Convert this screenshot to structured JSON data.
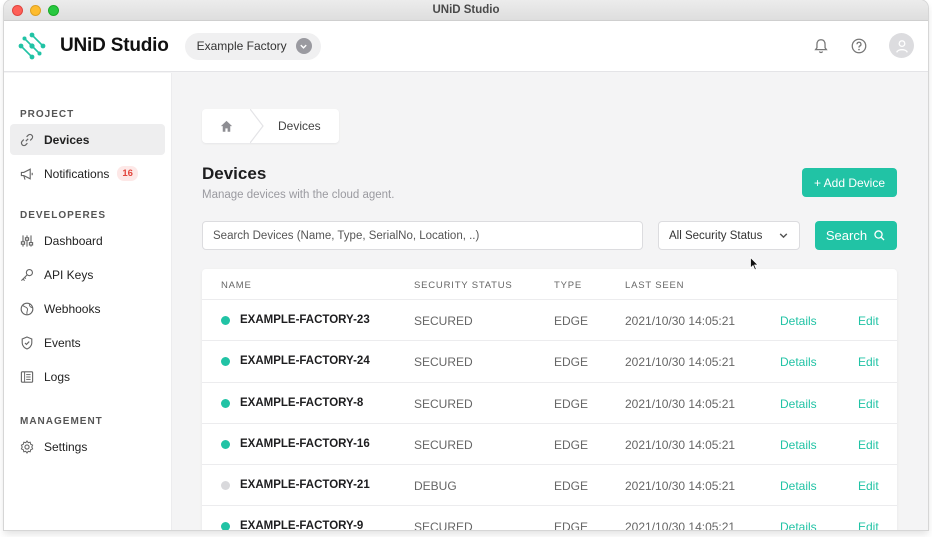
{
  "window": {
    "title": "UNiD Studio"
  },
  "brand": {
    "name": "UNiD Studio",
    "logo": "unid-logo-icon",
    "accent": "#21c3a5"
  },
  "project_selector": {
    "value": "Example Factory"
  },
  "sidebar": {
    "sections": [
      {
        "title": "PROJECT",
        "items": [
          {
            "label": "Devices",
            "icon": "link-icon",
            "active": true
          },
          {
            "label": "Notifications",
            "icon": "megaphone-icon",
            "badge": "16"
          }
        ]
      },
      {
        "title": "DEVELOPERES",
        "items": [
          {
            "label": "Dashboard",
            "icon": "sliders-icon"
          },
          {
            "label": "API Keys",
            "icon": "key-icon"
          },
          {
            "label": "Webhooks",
            "icon": "globe-icon"
          },
          {
            "label": "Events",
            "icon": "shield-icon"
          },
          {
            "label": "Logs",
            "icon": "logs-icon"
          }
        ]
      },
      {
        "title": "MANAGEMENT",
        "items": [
          {
            "label": "Settings",
            "icon": "gear-icon"
          }
        ]
      }
    ]
  },
  "breadcrumb": {
    "home_icon": "home-icon",
    "current": "Devices"
  },
  "page": {
    "title": "Devices",
    "subtitle": "Manage devices with the cloud agent.",
    "add_button": "+ Add Device"
  },
  "filters": {
    "search_placeholder": "Search Devices (Name, Type, SerialNo, Location, ..)",
    "status_select": "All Security Status",
    "search_button": "Search"
  },
  "table": {
    "headers": {
      "name": "NAME",
      "status": "SECURITY STATUS",
      "type": "TYPE",
      "last_seen": "LAST SEEN"
    },
    "rows": [
      {
        "name": "EXAMPLE-FACTORY-23",
        "status": "SECURED",
        "type": "EDGE",
        "last_seen": "2021/10/30 14:05:21",
        "details": "Details",
        "edit": "Edit",
        "dot_color": "#21c3a5"
      },
      {
        "name": "EXAMPLE-FACTORY-24",
        "status": "SECURED",
        "type": "EDGE",
        "last_seen": "2021/10/30 14:05:21",
        "details": "Details",
        "edit": "Edit",
        "dot_color": "#21c3a5"
      },
      {
        "name": "EXAMPLE-FACTORY-8",
        "status": "SECURED",
        "type": "EDGE",
        "last_seen": "2021/10/30 14:05:21",
        "details": "Details",
        "edit": "Edit",
        "dot_color": "#21c3a5"
      },
      {
        "name": "EXAMPLE-FACTORY-16",
        "status": "SECURED",
        "type": "EDGE",
        "last_seen": "2021/10/30 14:05:21",
        "details": "Details",
        "edit": "Edit",
        "dot_color": "#21c3a5"
      },
      {
        "name": "EXAMPLE-FACTORY-21",
        "status": "DEBUG",
        "type": "EDGE",
        "last_seen": "2021/10/30 14:05:21",
        "details": "Details",
        "edit": "Edit",
        "dot_color": "#d9d9dc"
      },
      {
        "name": "EXAMPLE-FACTORY-9",
        "status": "SECURED",
        "type": "EDGE",
        "last_seen": "2021/10/30 14:05:21",
        "details": "Details",
        "edit": "Edit",
        "dot_color": "#21c3a5"
      }
    ]
  }
}
